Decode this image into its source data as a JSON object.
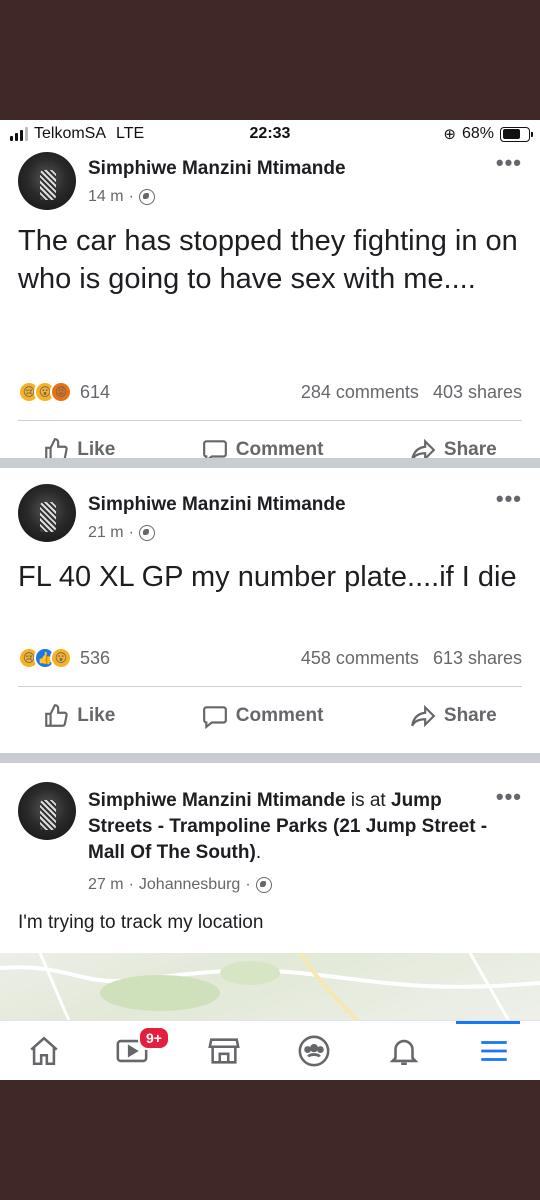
{
  "status_bar": {
    "carrier": "TelkomSA",
    "network": "LTE",
    "time": "22:33",
    "battery": "68%",
    "battery_level": 0.68
  },
  "posts": [
    {
      "author": "Simphiwe Manzini Mtimande",
      "time": "14 m",
      "separator": "·",
      "text": "The car has stopped they fighting in on who is going to have sex with me....",
      "reactions": [
        "sad",
        "wow",
        "angry"
      ],
      "reaction_count": "614",
      "comments": "284 comments",
      "shares": "403 shares"
    },
    {
      "author": "Simphiwe Manzini Mtimande",
      "time": "21 m",
      "separator": "·",
      "text": "FL 40 XL GP my number plate....if I die",
      "reactions": [
        "sad",
        "like",
        "wow"
      ],
      "reaction_count": "536",
      "comments": "458 comments",
      "shares": "613 shares"
    },
    {
      "author": "Simphiwe Manzini Mtimande",
      "checkin_is_at": "is at",
      "place": "Jump Streets - Trampoline Parks (21 Jump Street - Mall Of The South)",
      "place_end": ".",
      "time": "27 m",
      "location": "Johannesburg",
      "separator": "·",
      "text": "I'm trying to track my location"
    }
  ],
  "actions": {
    "like": "Like",
    "comment": "Comment",
    "share": "Share"
  },
  "tabbar": {
    "tabs": [
      "home-icon",
      "watch-icon",
      "marketplace-icon",
      "groups-icon",
      "notifications-icon",
      "menu-icon"
    ],
    "watch_badge": "9+",
    "active": "menu-icon"
  },
  "colors": {
    "accent": "#1877f2",
    "badge": "#e41e3f",
    "text_secondary": "#65676b"
  }
}
